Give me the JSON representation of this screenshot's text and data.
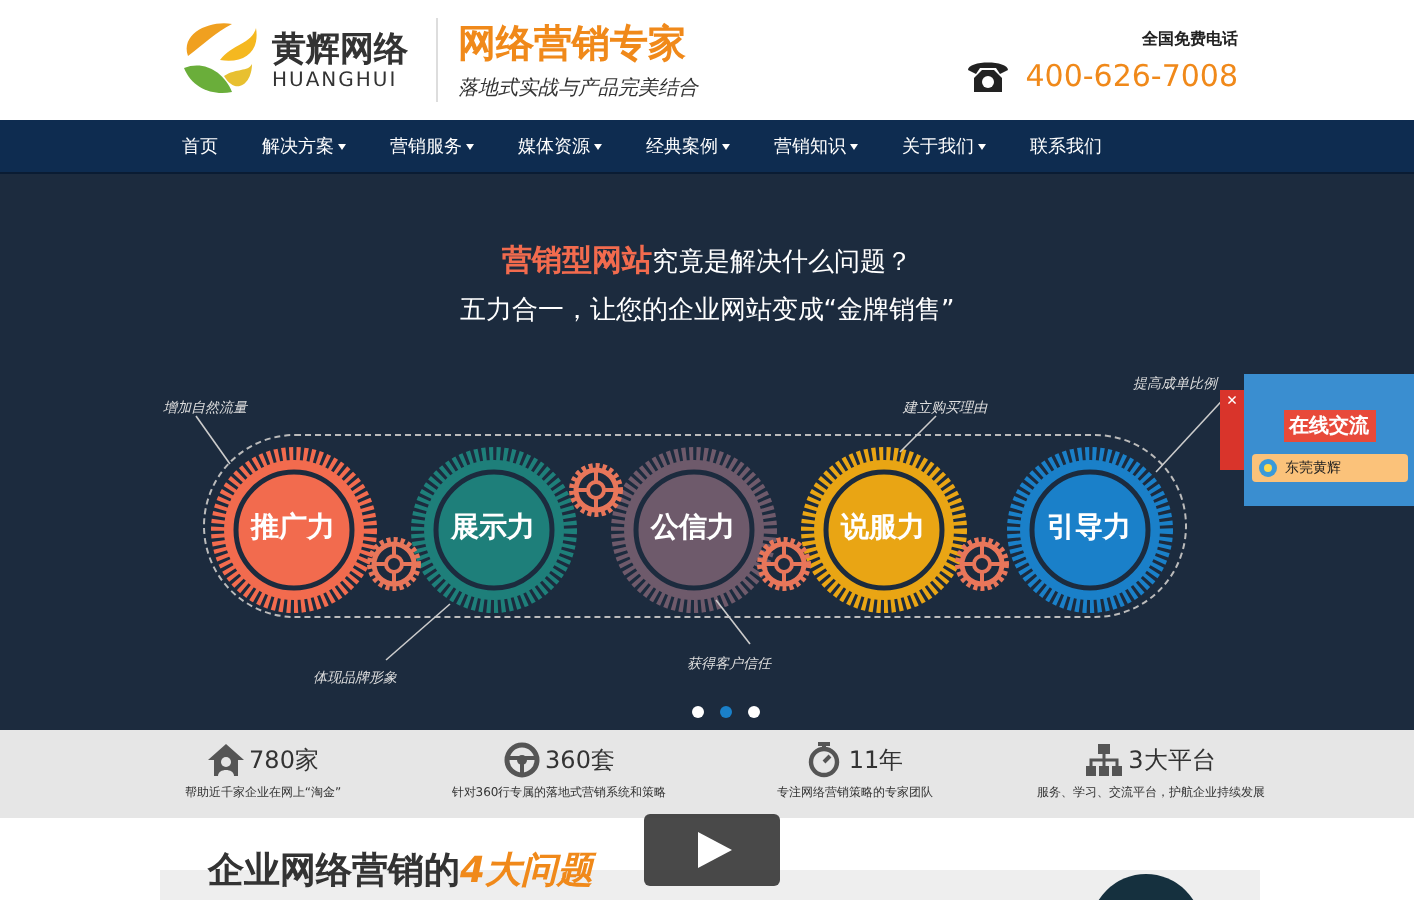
{
  "header": {
    "logo_name": "黄辉网络",
    "logo_latin": "HUANGHUI",
    "tagline": "网络营销专家",
    "slogan": "落地式实战与产品完美结合",
    "hotline_label": "全国免费电话",
    "hotline_number": "400-626-7008"
  },
  "nav": [
    {
      "label": "首页",
      "has_menu": false
    },
    {
      "label": "解决方案",
      "has_menu": true
    },
    {
      "label": "营销服务",
      "has_menu": true
    },
    {
      "label": "媒体资源",
      "has_menu": true
    },
    {
      "label": "经典案例",
      "has_menu": true
    },
    {
      "label": "营销知识",
      "has_menu": true
    },
    {
      "label": "关于我们",
      "has_menu": true
    },
    {
      "label": "联系我们",
      "has_menu": false
    }
  ],
  "banner": {
    "title_highlight": "营销型网站",
    "title_rest": "究竟是解决什么问题？",
    "subtitle": "五力合一，让您的企业网站变成“金牌销售”",
    "gears": [
      {
        "label": "推广力",
        "color": "#f26b4e"
      },
      {
        "label": "展示力",
        "color": "#1e7f7a"
      },
      {
        "label": "公信力",
        "color": "#6e5a6b"
      },
      {
        "label": "说服力",
        "color": "#e9a514"
      },
      {
        "label": "引导力",
        "color": "#1a80c9"
      }
    ],
    "annotations": [
      {
        "text": "增加自然流量"
      },
      {
        "text": "体现品牌形象"
      },
      {
        "text": "获得客户信任"
      },
      {
        "text": "建立购买理由"
      },
      {
        "text": "提高成单比例"
      }
    ],
    "slides": [
      {
        "selected": false
      },
      {
        "selected": true
      },
      {
        "selected": false
      }
    ]
  },
  "chat_widget": {
    "title": "在线交流",
    "contact": "东莞黄辉",
    "close": "×"
  },
  "stats": [
    {
      "value": "780家",
      "caption": "帮助近千家企业在网上“淘金”"
    },
    {
      "value": "360套",
      "caption": "针对360行专属的落地式营销系统和策略"
    },
    {
      "value": "11年",
      "caption": "专注网络营销策略的专家团队"
    },
    {
      "value": "3大平台",
      "caption": "服务、学习、交流平台，护航企业持续发展"
    }
  ],
  "section": {
    "heading": "企业网络营销的",
    "heading_highlight": "4大问题"
  }
}
